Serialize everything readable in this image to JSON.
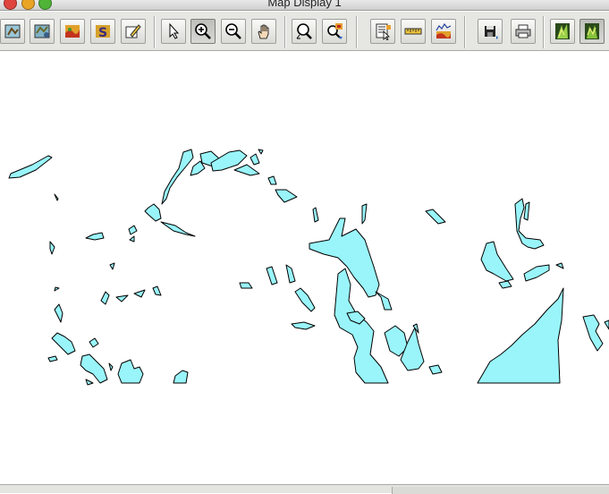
{
  "window": {
    "title": "Map Display 1"
  },
  "toolbar": {
    "buttons": [
      {
        "name": "open-map-button",
        "icon": "map-icon"
      },
      {
        "name": "add-layer-button",
        "icon": "layers-icon"
      },
      {
        "name": "raster-layer-button",
        "icon": "raster-icon"
      },
      {
        "name": "symbol-button",
        "icon": "symbol-icon"
      },
      {
        "name": "edit-button",
        "icon": "pencil-icon"
      },
      {
        "name": "pointer-tool-button",
        "icon": "pointer-icon"
      },
      {
        "name": "zoom-in-button",
        "icon": "zoom-in-icon",
        "active": true
      },
      {
        "name": "zoom-out-button",
        "icon": "zoom-out-icon"
      },
      {
        "name": "pan-button",
        "icon": "hand-icon"
      },
      {
        "name": "zoom-extent-button",
        "icon": "zoom-extent-icon"
      },
      {
        "name": "query-button",
        "icon": "query-icon"
      },
      {
        "name": "attribute-button",
        "icon": "report-icon"
      },
      {
        "name": "measure-button",
        "icon": "ruler-icon"
      },
      {
        "name": "histogram-button",
        "icon": "histogram-icon"
      },
      {
        "name": "save-button",
        "icon": "floppy-icon"
      },
      {
        "name": "print-button",
        "icon": "printer-icon"
      },
      {
        "name": "nviz-button",
        "icon": "nviz-icon"
      },
      {
        "name": "nviz-2-button",
        "icon": "nviz-icon"
      }
    ]
  },
  "map": {
    "fill_color": "#99f5fa",
    "stroke_color": "#000000",
    "background": "#ffffff"
  }
}
